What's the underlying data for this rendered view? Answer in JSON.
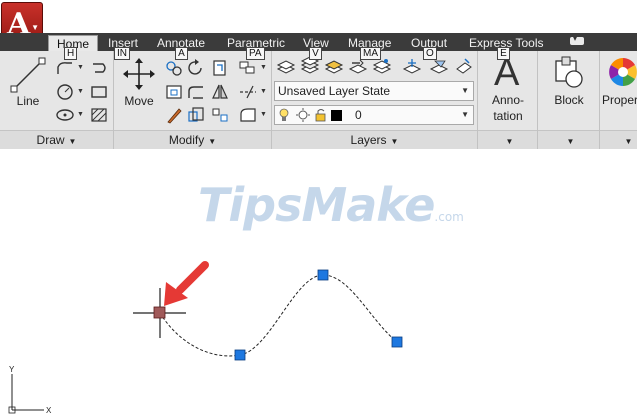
{
  "app": {
    "logo_letter": "A"
  },
  "tabs": [
    {
      "label": "Home",
      "keytip": "H",
      "active": true
    },
    {
      "label": "Insert",
      "keytip": "IN"
    },
    {
      "label": "Annotate",
      "keytip": "A"
    },
    {
      "label": "Parametric",
      "keytip": "PA"
    },
    {
      "label": "View",
      "keytip": "V"
    },
    {
      "label": "Manage",
      "keytip": "MA"
    },
    {
      "label": "Output",
      "keytip": "O"
    },
    {
      "label": "Express Tools",
      "keytip": "E"
    }
  ],
  "panels": {
    "draw": {
      "footer": "Draw",
      "line_label": "Line"
    },
    "modify": {
      "footer": "Modify",
      "move_label": "Move"
    },
    "layers": {
      "footer": "Layers",
      "layer_state": "Unsaved Layer State",
      "current_layer": "0"
    },
    "annotation": {
      "label_line1": "Anno-",
      "label_line2": "tation"
    },
    "block": {
      "label": "Block"
    },
    "properties": {
      "label": "Proper"
    }
  },
  "watermark": {
    "text": "TipsMake",
    "suffix": ".com"
  },
  "ucs": {
    "x_label": "X",
    "y_label": "Y"
  },
  "colors": {
    "grip": "#1e78e0",
    "ribbon": "#e6e6e6",
    "tabbar": "#3b3b3b",
    "arrow": "#e53935"
  }
}
